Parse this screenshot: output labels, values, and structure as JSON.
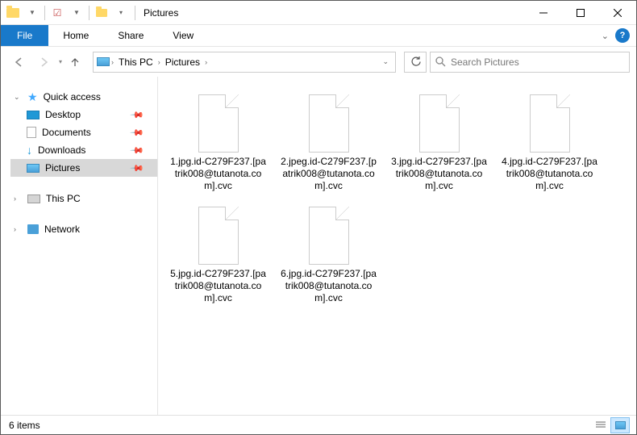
{
  "window": {
    "title": "Pictures"
  },
  "ribbon": {
    "file": "File",
    "tabs": [
      "Home",
      "Share",
      "View"
    ]
  },
  "breadcrumb": {
    "items": [
      "This PC",
      "Pictures"
    ]
  },
  "search": {
    "placeholder": "Search Pictures"
  },
  "nav": {
    "quick_access": "Quick access",
    "items": [
      "Desktop",
      "Documents",
      "Downloads",
      "Pictures"
    ],
    "this_pc": "This PC",
    "network": "Network"
  },
  "files": [
    {
      "name": "1.jpg.id-C279F237.[patrik008@tutanota.com].cvc"
    },
    {
      "name": "2.jpeg.id-C279F237.[patrik008@tutanota.com].cvc"
    },
    {
      "name": "3.jpg.id-C279F237.[patrik008@tutanota.com].cvc"
    },
    {
      "name": "4.jpg.id-C279F237.[patrik008@tutanota.com].cvc"
    },
    {
      "name": "5.jpg.id-C279F237.[patrik008@tutanota.com].cvc"
    },
    {
      "name": "6.jpg.id-C279F237.[patrik008@tutanota.com].cvc"
    }
  ],
  "status": {
    "count": "6 items"
  }
}
